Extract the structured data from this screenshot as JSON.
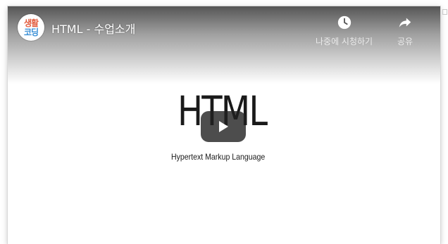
{
  "video": {
    "title": "HTML - 수업소개",
    "play_icon": "play-icon"
  },
  "channel": {
    "avatar_line1": "생활",
    "avatar_line2": "코딩"
  },
  "actions": {
    "watch_later_label": "나중에 시청하기",
    "watch_later_icon": "clock-icon",
    "share_label": "공유",
    "share_icon": "share-icon"
  },
  "slide": {
    "title": "HTML",
    "subtitle": "Hypertext Markup Language"
  },
  "colors": {
    "avatar_accent_1": "#e25d3f",
    "avatar_accent_2": "#3a8fd6",
    "play_button": "#212121"
  }
}
